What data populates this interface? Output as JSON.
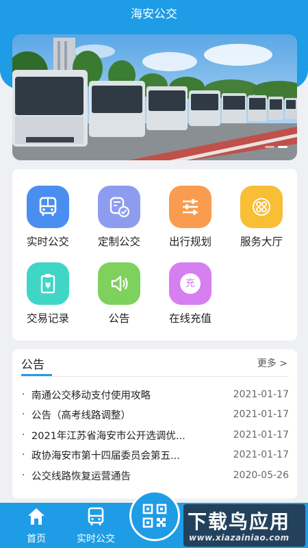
{
  "header": {
    "title": "海安公交"
  },
  "services": [
    {
      "label": "实时公交",
      "icon": "bus-icon",
      "color": "#4a8ff0"
    },
    {
      "label": "定制公交",
      "icon": "custom-bus-icon",
      "color": "#8e9cf0"
    },
    {
      "label": "出行规划",
      "icon": "sliders-icon",
      "color": "#f99c4f"
    },
    {
      "label": "服务大厅",
      "icon": "service-hall-icon",
      "color": "#f7be36"
    },
    {
      "label": "交易记录",
      "icon": "transaction-icon",
      "color": "#3fd6c6"
    },
    {
      "label": "公告",
      "icon": "speaker-icon",
      "color": "#7ed15c"
    },
    {
      "label": "在线充值",
      "icon": "recharge-icon",
      "color": "#d67ff0",
      "badge": "充"
    }
  ],
  "announcements": {
    "title": "公告",
    "more": "更多 >",
    "items": [
      {
        "bullet": "·",
        "title": "南通公交移动支付使用攻略",
        "date": "2021-01-17"
      },
      {
        "bullet": "·",
        "title": "公告（高考线路调整）",
        "date": "2021-01-17"
      },
      {
        "bullet": "·",
        "title": "2021年江苏省海安市公开选调优...",
        "date": "2021-01-17"
      },
      {
        "bullet": "·",
        "title": "政协海安市第十四届委员会第五...",
        "date": "2021-01-17"
      },
      {
        "bullet": "·",
        "title": "公交线路恢复运营通告",
        "date": "2020-05-26"
      }
    ]
  },
  "tabbar": {
    "home": "首页",
    "realtime": "实时公交"
  },
  "watermark": {
    "main": "下载鸟应用",
    "sub": "www.xiazainiao.com"
  },
  "colors": {
    "primary": "#1e9ce6",
    "background": "#eef0f3"
  }
}
